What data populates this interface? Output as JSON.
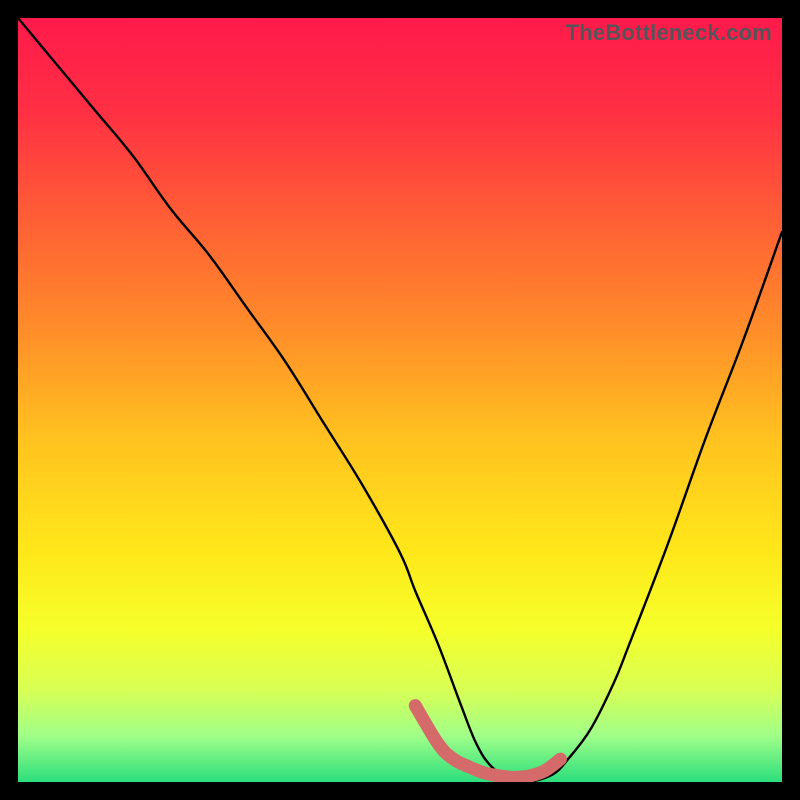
{
  "watermark": "TheBottleneck.com",
  "colors": {
    "page_bg": "#000000",
    "gradient_stops": [
      {
        "offset": 0.0,
        "color": "#ff1a4b"
      },
      {
        "offset": 0.12,
        "color": "#ff2f44"
      },
      {
        "offset": 0.25,
        "color": "#ff5a36"
      },
      {
        "offset": 0.4,
        "color": "#ff8a2a"
      },
      {
        "offset": 0.55,
        "color": "#ffc21f"
      },
      {
        "offset": 0.7,
        "color": "#ffe81a"
      },
      {
        "offset": 0.8,
        "color": "#f5ff2a"
      },
      {
        "offset": 0.88,
        "color": "#d8ff55"
      },
      {
        "offset": 0.94,
        "color": "#9fff89"
      },
      {
        "offset": 1.0,
        "color": "#2bde7c"
      }
    ],
    "curve_stroke": "#000000",
    "sweet_spot_stroke": "#d56a6a"
  },
  "chart_data": {
    "type": "line",
    "title": "",
    "xlabel": "",
    "ylabel": "",
    "xlim": [
      0,
      100
    ],
    "ylim": [
      0,
      100
    ],
    "grid": false,
    "legend": false,
    "series": [
      {
        "name": "bottleneck-curve",
        "x": [
          0,
          5,
          10,
          15,
          20,
          25,
          30,
          35,
          40,
          45,
          50,
          52,
          55,
          58,
          60,
          62,
          65,
          67,
          70,
          72,
          75,
          78,
          80,
          85,
          90,
          95,
          100
        ],
        "values": [
          100,
          94,
          88,
          82,
          75,
          69,
          62,
          55,
          47,
          39,
          30,
          25,
          18,
          10,
          5,
          2,
          0,
          0,
          1,
          3,
          7,
          13,
          18,
          31,
          45,
          58,
          72
        ]
      },
      {
        "name": "sweet-spot-zone",
        "x": [
          52,
          55,
          57,
          59,
          61,
          63,
          65,
          67,
          69,
          71
        ],
        "values": [
          10,
          5,
          3,
          2,
          1.2,
          0.8,
          0.6,
          0.8,
          1.5,
          3
        ]
      }
    ]
  }
}
